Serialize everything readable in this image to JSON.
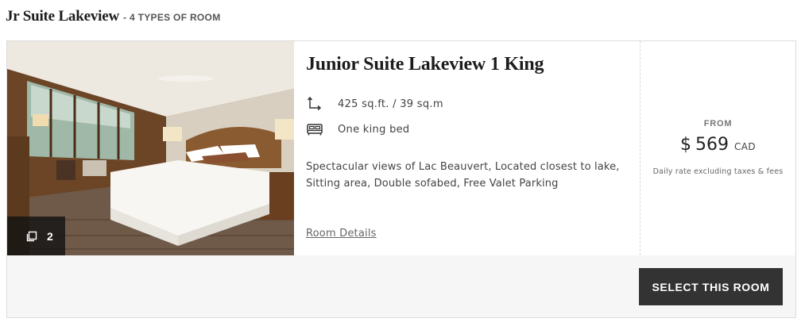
{
  "section": {
    "title": "Jr Suite Lakeview",
    "separator": "-",
    "subtitle": "4 TYPES OF ROOM"
  },
  "room": {
    "name": "Junior Suite Lakeview 1 King",
    "photo": {
      "count": "2",
      "icon": "gallery-icon"
    },
    "size": {
      "icon": "room-size-icon",
      "text": "425 sq.ft. / 39 sq.m"
    },
    "bed": {
      "icon": "bed-icon",
      "text": "One king bed"
    },
    "description": "Spectacular views of Lac Beauvert, Located closest to lake, Sitting area, Double sofabed, Free Valet Parking",
    "details_link": "Room Details"
  },
  "price": {
    "from_label": "FROM",
    "currency_symbol": "$",
    "amount": "569",
    "currency_code": "CAD",
    "note": "Daily rate excluding taxes & fees"
  },
  "actions": {
    "select_label": "SELECT THIS ROOM"
  },
  "colors": {
    "button_bg": "#333333",
    "footer_bg": "#f6f6f6",
    "border": "#dcdcdc"
  }
}
